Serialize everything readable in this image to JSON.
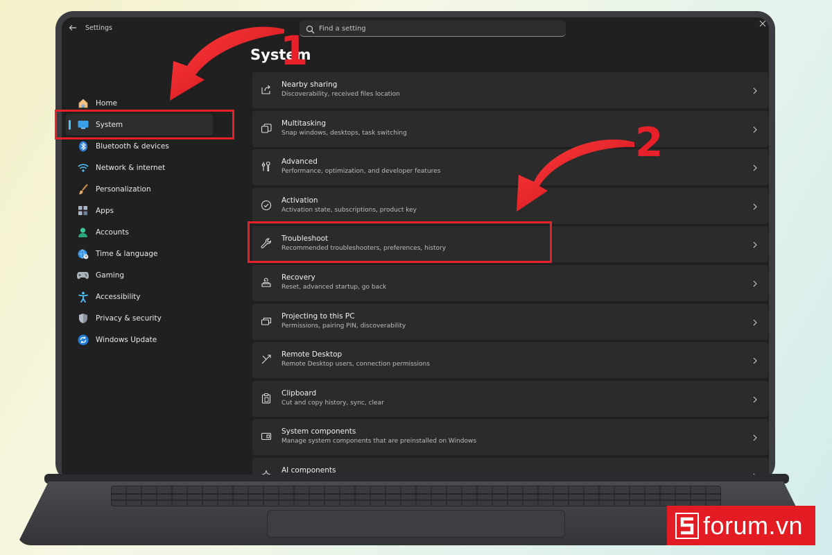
{
  "window": {
    "title": "Settings",
    "search_placeholder": "Find a setting"
  },
  "sidebar": {
    "items": [
      {
        "label": "Home",
        "icon": "home-icon"
      },
      {
        "label": "System",
        "icon": "monitor-icon",
        "active": true
      },
      {
        "label": "Bluetooth & devices",
        "icon": "bluetooth-icon"
      },
      {
        "label": "Network & internet",
        "icon": "wifi-icon"
      },
      {
        "label": "Personalization",
        "icon": "brush-icon"
      },
      {
        "label": "Apps",
        "icon": "apps-icon"
      },
      {
        "label": "Accounts",
        "icon": "person-icon"
      },
      {
        "label": "Time & language",
        "icon": "globe-clock-icon"
      },
      {
        "label": "Gaming",
        "icon": "gamepad-icon"
      },
      {
        "label": "Accessibility",
        "icon": "accessibility-icon"
      },
      {
        "label": "Privacy & security",
        "icon": "shield-icon"
      },
      {
        "label": "Windows Update",
        "icon": "update-icon"
      }
    ]
  },
  "main": {
    "title": "System",
    "rows": [
      {
        "title": "Nearby sharing",
        "desc": "Discoverability, received files location",
        "icon": "share-icon"
      },
      {
        "title": "Multitasking",
        "desc": "Snap windows, desktops, task switching",
        "icon": "multitask-icon"
      },
      {
        "title": "Advanced",
        "desc": "Performance, optimization, and developer features",
        "icon": "tools-icon"
      },
      {
        "title": "Activation",
        "desc": "Activation state, subscriptions, product key",
        "icon": "check-circle-icon"
      },
      {
        "title": "Troubleshoot",
        "desc": "Recommended troubleshooters, preferences, history",
        "icon": "wrench-icon"
      },
      {
        "title": "Recovery",
        "desc": "Reset, advanced startup, go back",
        "icon": "recovery-icon"
      },
      {
        "title": "Projecting to this PC",
        "desc": "Permissions, pairing PIN, discoverability",
        "icon": "projector-icon"
      },
      {
        "title": "Remote Desktop",
        "desc": "Remote Desktop users, connection permissions",
        "icon": "remote-desktop-icon"
      },
      {
        "title": "Clipboard",
        "desc": "Cut and copy history, sync, clear",
        "icon": "clipboard-icon"
      },
      {
        "title": "System components",
        "desc": "Manage system components that are preinstalled on Windows",
        "icon": "components-icon"
      },
      {
        "title": "AI components",
        "desc": "",
        "icon": "ai-icon"
      }
    ]
  },
  "annotations": {
    "step1": "1",
    "step2": "2",
    "color": "#e8202a"
  },
  "brand": {
    "text": "forum.vn",
    "color": "#e31b22"
  },
  "colors": {
    "accent": "#4cc2ff",
    "background": "#202020",
    "card": "#2b2b2b"
  }
}
